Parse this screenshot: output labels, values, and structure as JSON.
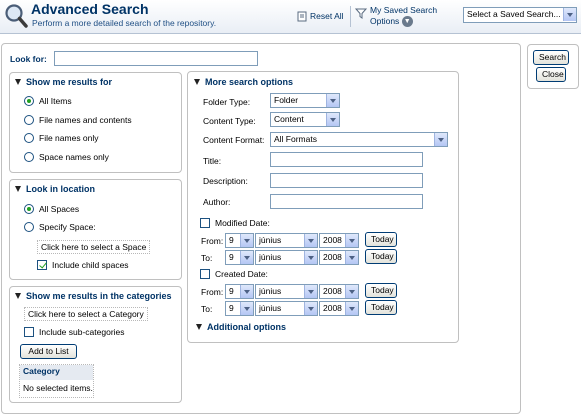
{
  "header": {
    "title": "Advanced Search",
    "subtitle": "Perform a more detailed search of the repository.",
    "reset_all": "Reset All",
    "saved_options": [
      "My Saved Search",
      "Options"
    ],
    "saved_select": "Select a Saved Search..."
  },
  "side_buttons": {
    "search": "Search",
    "close": "Close"
  },
  "look_for": {
    "label": "Look for:",
    "value": ""
  },
  "results_for": {
    "title": "Show me results for",
    "selected": "All Items",
    "options": [
      "All Items",
      "File names and contents",
      "File names only",
      "Space names only"
    ]
  },
  "location": {
    "title": "Look in location",
    "options": [
      "All Spaces",
      "Specify Space:"
    ],
    "selected": "All Spaces",
    "select_space": "Click here to select a Space",
    "include_child": "Include child spaces",
    "include_child_checked": true
  },
  "categories": {
    "title": "Show me results in the categories",
    "select_category": "Click here to select a Category",
    "include_sub": "Include sub-categories",
    "include_sub_checked": false,
    "add_to_list": "Add to List",
    "table_header": "Category",
    "empty_text": "No selected items."
  },
  "more_options": {
    "title": "More search options",
    "folder_type_label": "Folder Type:",
    "folder_type": "Folder",
    "content_type_label": "Content Type:",
    "content_type": "Content",
    "content_format_label": "Content Format:",
    "content_format": "All Formats",
    "title_label": "Title:",
    "description_label": "Description:",
    "author_label": "Author:",
    "modified_date_label": "Modified Date:",
    "created_date_label": "Created Date:",
    "from_label": "From:",
    "to_label": "To:",
    "day": "9",
    "month": "június",
    "year": "2008",
    "today": "Today",
    "additional": "Additional options"
  },
  "colors": {
    "title": "#003366",
    "accent_green": "#21a121"
  },
  "icons": {
    "logo": "magnifier-icon",
    "reset": "reset-icon",
    "filter": "filter-funnel-icon",
    "dropdown": "chevron-down-icon"
  }
}
